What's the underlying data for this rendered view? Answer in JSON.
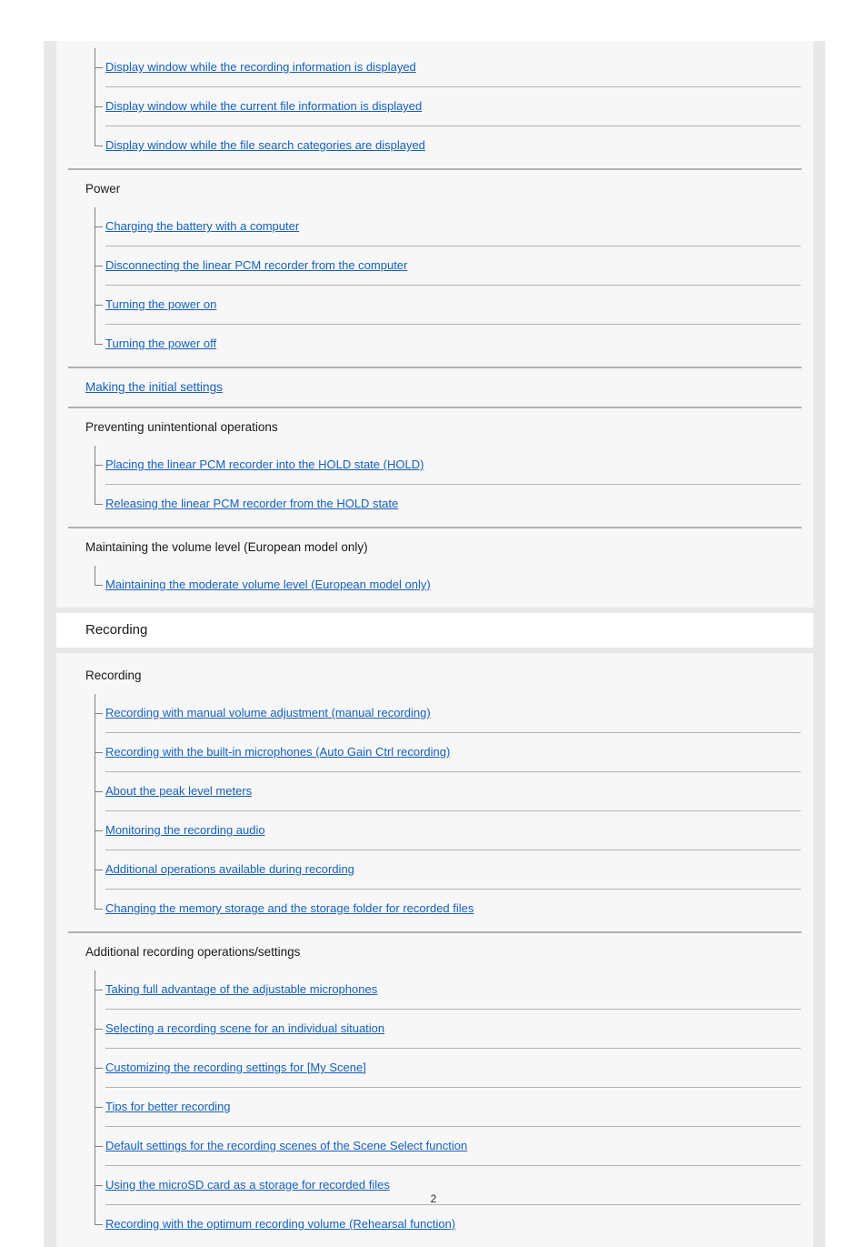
{
  "document": {
    "page_number": "2",
    "link_color": "#1560bd",
    "rule_color": "#b0b0b0",
    "block_bg": "#f7f7f7",
    "frame_bg": "#e8e8e8",
    "chapter_bg": "#ffffff"
  },
  "blocks": [
    {
      "id": "block-getting-started",
      "type": "content",
      "groups": [
        {
          "kind": "tree",
          "items": [
            "Display window while the recording information is displayed",
            "Display window while the current file information is displayed",
            "Display window while the file search categories are displayed"
          ]
        },
        {
          "kind": "section",
          "heading": "Power",
          "items": [
            "Charging the battery with a computer",
            "Disconnecting the linear PCM recorder from the computer",
            "Turning the power on",
            "Turning the power off"
          ]
        },
        {
          "kind": "toplink",
          "label": "Making the initial settings"
        },
        {
          "kind": "section",
          "heading": "Preventing unintentional operations",
          "items": [
            "Placing the linear PCM recorder into the HOLD state (HOLD)",
            "Releasing the linear PCM recorder from the HOLD state"
          ]
        },
        {
          "kind": "section",
          "heading": "Maintaining the volume level (European model only)",
          "items": [
            "Maintaining the moderate volume level (European model only)"
          ]
        }
      ]
    },
    {
      "id": "chapter-recording",
      "type": "chapter",
      "title": "Recording"
    },
    {
      "id": "block-recording",
      "type": "content",
      "groups": [
        {
          "kind": "section-first",
          "heading": "Recording",
          "items": [
            "Recording with manual volume adjustment (manual recording)",
            "Recording with the built-in microphones (Auto Gain Ctrl recording)",
            "About the peak level meters",
            "Monitoring the recording audio",
            "Additional operations available during recording",
            "Changing the memory storage and the storage folder for recorded files"
          ]
        },
        {
          "kind": "section",
          "heading": "Additional recording operations/settings",
          "items": [
            "Taking full advantage of the adjustable microphones",
            "Selecting a recording scene for an individual situation",
            "Customizing the recording settings for [My Scene]",
            "Tips for better recording",
            "Default settings for the recording scenes of the Scene Select function",
            "Using the microSD card as a storage for recorded files",
            "Recording with the optimum recording volume (Rehearsal function)"
          ]
        }
      ]
    }
  ]
}
